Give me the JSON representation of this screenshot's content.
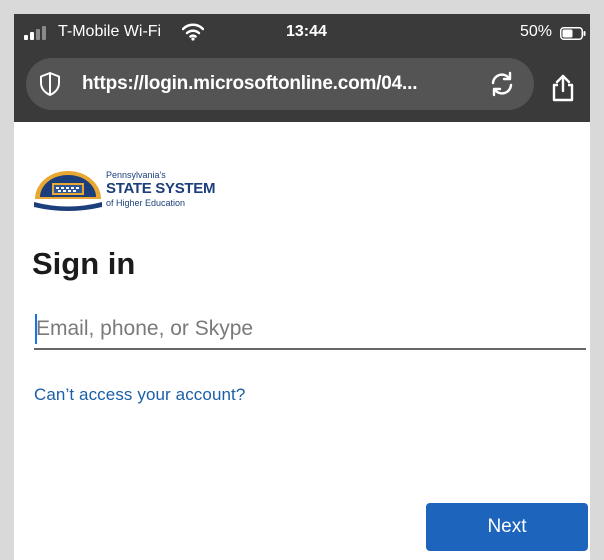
{
  "status_bar": {
    "carrier": "T-Mobile Wi-Fi",
    "time": "13:44",
    "battery": "50%"
  },
  "browser": {
    "url": "https://login.microsoftonline.com/04..."
  },
  "logo": {
    "line1": "Pennsylvania's",
    "line2": "STATE SYSTEM",
    "line3": "of Higher Education"
  },
  "signin": {
    "title": "Sign in",
    "email_placeholder": "Email, phone, or Skype",
    "email_value": "",
    "cant_access_link": "Can’t access your account?",
    "next_label": "Next"
  },
  "colors": {
    "chrome_bg": "#3a3a3a",
    "url_pill": "#545454",
    "link": "#1a5fa8",
    "button": "#1d64bd",
    "logo_navy": "#1c3f7c",
    "logo_gold": "#e8a831"
  },
  "icons": [
    "signal-bars-icon",
    "wifi-icon",
    "battery-icon",
    "shield-icon",
    "reload-icon",
    "share-icon"
  ]
}
